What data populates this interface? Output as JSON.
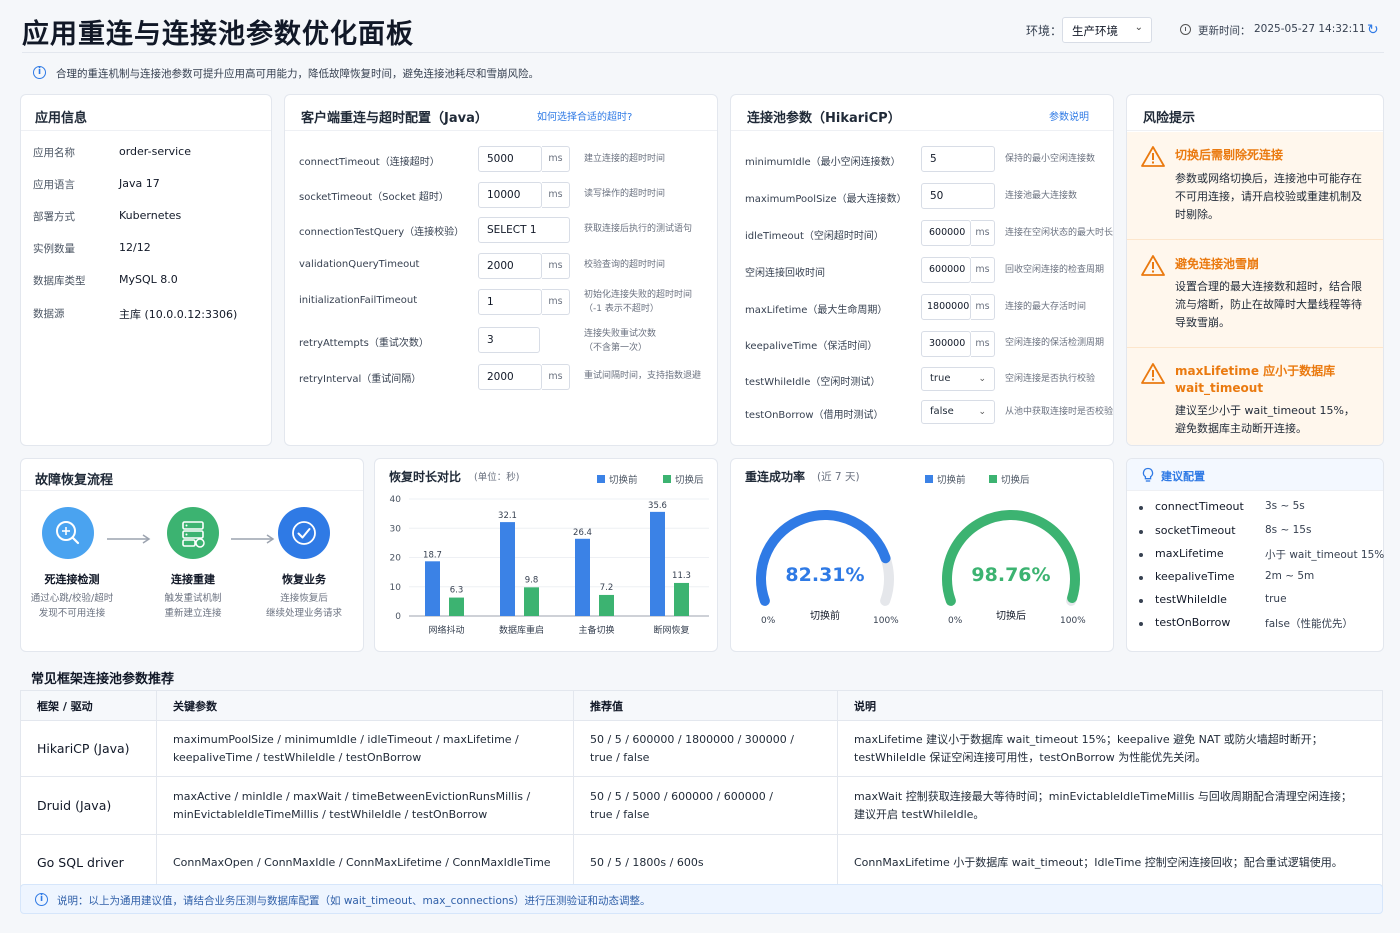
{
  "header": {
    "title": "应用重连与连接池参数优化面板",
    "env_label": "环境：",
    "env_value": "生产环境",
    "updated_label": "更新时间：",
    "updated_value": "2025-05-27 14:32:11",
    "notice": "合理的重连机制与连接池参数可提升应用高可用能力，降低故障恢复时间，避免连接池耗尽和雪崩风险。"
  },
  "app_info": {
    "title": "应用信息",
    "rows": [
      {
        "k": "应用名称",
        "v": "order-service"
      },
      {
        "k": "应用语言",
        "v": "Java 17"
      },
      {
        "k": "部署方式",
        "v": "Kubernetes"
      },
      {
        "k": "实例数量",
        "v": "12/12"
      },
      {
        "k": "数据库类型",
        "v": "MySQL 8.0"
      },
      {
        "k": "数据源",
        "v": "主库 (10.0.0.12:3306)"
      }
    ]
  },
  "client": {
    "title": "客户端重连与超时配置（Java）",
    "link": "如何选择合适的超时?",
    "rows": [
      {
        "label": "connectTimeout（连接超时）",
        "value": "5000",
        "unit": "ms",
        "hint": "建立连接的超时时间"
      },
      {
        "label": "socketTimeout（Socket 超时）",
        "value": "10000",
        "unit": "ms",
        "hint": "读写操作的超时时间"
      },
      {
        "label": "connectionTestQuery（连接校验）",
        "value": "SELECT 1",
        "unit": "",
        "hint": "获取连接后执行的测试语句"
      },
      {
        "label": "validationQueryTimeout",
        "value": "2000",
        "unit": "ms",
        "hint": "校验查询的超时时间"
      },
      {
        "label": "initializationFailTimeout",
        "value": "1",
        "unit": "ms",
        "hint": "初始化连接失败的超时时间",
        "hint2": "（-1 表示不超时）"
      },
      {
        "label": "retryAttempts（重试次数）",
        "value": "3",
        "unit": "",
        "hint": "连接失败重试次数",
        "hint2": "（不含第一次）"
      },
      {
        "label": "retryInterval（重试间隔）",
        "value": "2000",
        "unit": "ms",
        "hint": "重试间隔时间，支持指数退避"
      }
    ]
  },
  "pool": {
    "title": "连接池参数（HikariCP）",
    "link": "参数说明",
    "rows": [
      {
        "label": "minimumIdle（最小空闲连接数）",
        "value": "5",
        "unit": "",
        "hint": "保持的最小空闲连接数"
      },
      {
        "label": "maximumPoolSize（最大连接数）",
        "value": "50",
        "unit": "",
        "hint": "连接池最大连接数"
      },
      {
        "label": "idleTimeout（空闲超时时间）",
        "value": "600000",
        "unit": "ms",
        "hint": "连接在空闲状态的最大时长"
      },
      {
        "label": "空闲连接回收时间",
        "value": "600000",
        "unit": "ms",
        "hint": "回收空闲连接的检查周期"
      },
      {
        "label": "maxLifetime（最大生命周期）",
        "value": "1800000",
        "unit": "ms",
        "hint": "连接的最大存活时间"
      },
      {
        "label": "keepaliveTime（保活时间）",
        "value": "300000",
        "unit": "ms",
        "hint": "空闲连接的保活检测周期"
      },
      {
        "label": "testWhileIdle（空闲时测试）",
        "value": "true",
        "select": true,
        "hint": "空闲连接是否执行校验"
      },
      {
        "label": "testOnBorrow（借用时测试）",
        "value": "false",
        "select": true,
        "hint": "从池中获取连接时是否校验"
      }
    ]
  },
  "risk": {
    "title": "风险提示",
    "items": [
      {
        "title": "切换后需剔除死连接",
        "body": "参数或网络切换后，连接池中可能存在不可用连接，请开启校验或重建机制及时剔除。"
      },
      {
        "title": "避免连接池雪崩",
        "body": "设置合理的最大连接数和超时，结合限流与熔断，防止在故障时大量线程等待导致雪崩。"
      },
      {
        "title": "maxLifetime 应小于数据库 wait_timeout",
        "body": "建议至少小于 wait_timeout 15%，避免数据库主动断开连接。"
      }
    ]
  },
  "flow": {
    "title": "故障恢复流程",
    "steps": [
      {
        "title": "死连接检测",
        "line1": "通过心跳/校验/超时",
        "line2": "发现不可用连接"
      },
      {
        "title": "连接重建",
        "line1": "触发重试机制",
        "line2": "重新建立连接"
      },
      {
        "title": "恢复业务",
        "line1": "连接恢复后",
        "line2": "继续处理业务请求"
      }
    ]
  },
  "recovery_chart": {
    "title": "恢复时长对比",
    "unit": "(单位：秒)",
    "legend_before": "切换前",
    "legend_after": "切换后",
    "ticks": [
      "0",
      "10",
      "20",
      "30",
      "40"
    ]
  },
  "success": {
    "title": "重连成功率",
    "subtitle": "(近 7 天)",
    "legend_before": "切换前",
    "legend_after": "切换后",
    "gauges": [
      {
        "value_text": "82.31%",
        "value": 82.31,
        "label": "切换前",
        "min": "0%",
        "max": "100%",
        "color": "#2f7ae5"
      },
      {
        "value_text": "98.76%",
        "value": 98.76,
        "label": "切换后",
        "min": "0%",
        "max": "100%",
        "color": "#3cb371"
      }
    ]
  },
  "recommend": {
    "title": "建议配置",
    "items": [
      {
        "k": "connectTimeout",
        "v": "3s ~ 5s"
      },
      {
        "k": "socketTimeout",
        "v": "8s ~ 15s"
      },
      {
        "k": "maxLifetime",
        "v": "小于 wait_timeout 15%"
      },
      {
        "k": "keepaliveTime",
        "v": "2m ~ 5m"
      },
      {
        "k": "testWhileIdle",
        "v": "true"
      },
      {
        "k": "testOnBorrow",
        "v": "false（性能优先）"
      }
    ]
  },
  "frameworks": {
    "title": "常见框架连接池参数推荐",
    "headers": [
      "框架 / 驱动",
      "关键参数",
      "推荐值",
      "说明"
    ],
    "rows": [
      {
        "name": "HikariCP (Java)",
        "params1": "maximumPoolSize / minimumIdle / idleTimeout / maxLifetime /",
        "params2": "keepaliveTime / testWhileIdle / testOnBorrow",
        "rec1": "50 / 5 / 600000 / 1800000 / 300000 /",
        "rec2": "true / false",
        "desc1": "maxLifetime 建议小于数据库 wait_timeout 15%；keepalive 避免 NAT 或防火墙超时断开；",
        "desc2": "testWhileIdle 保证空闲连接可用性，testOnBorrow 为性能优先关闭。"
      },
      {
        "name": "Druid (Java)",
        "params1": "maxActive / minIdle / maxWait / timeBetweenEvictionRunsMillis /",
        "params2": "minEvictableIdleTimeMillis / testWhileIdle / testOnBorrow",
        "rec1": "50 / 5 / 5000 / 600000 / 600000 /",
        "rec2": "true / false",
        "desc1": "maxWait 控制获取连接最大等待时间；minEvictableIdleTimeMillis 与回收周期配合清理空闲连接；",
        "desc2": "建议开启 testWhileIdle。"
      },
      {
        "name": "Go SQL driver",
        "params1": "ConnMaxOpen / ConnMaxIdle / ConnMaxLifetime / ConnMaxIdleTime",
        "params2": "",
        "rec1": "50 / 5 / 1800s / 600s",
        "rec2": "",
        "desc1": "ConnMaxLifetime 小于数据库 wait_timeout；IdleTime 控制空闲连接回收；配合重试逻辑使用。",
        "desc2": ""
      }
    ]
  },
  "footer_note": "说明：以上为通用建议值，请结合业务压测与数据库配置（如 wait_timeout、max_connections）进行压测验证和动态调整。",
  "chart_data": {
    "type": "bar",
    "title": "恢复时长对比",
    "categories": [
      "网络抖动",
      "数据库重启",
      "主备切换",
      "断网恢复"
    ],
    "series": [
      {
        "name": "切换前",
        "values": [
          18.7,
          32.1,
          26.4,
          35.6
        ],
        "color": "#3b82e6"
      },
      {
        "name": "切换后",
        "values": [
          6.3,
          9.8,
          7.2,
          11.3
        ],
        "color": "#3cb371"
      }
    ],
    "ylim": [
      0,
      40
    ],
    "legend": "top-right"
  }
}
